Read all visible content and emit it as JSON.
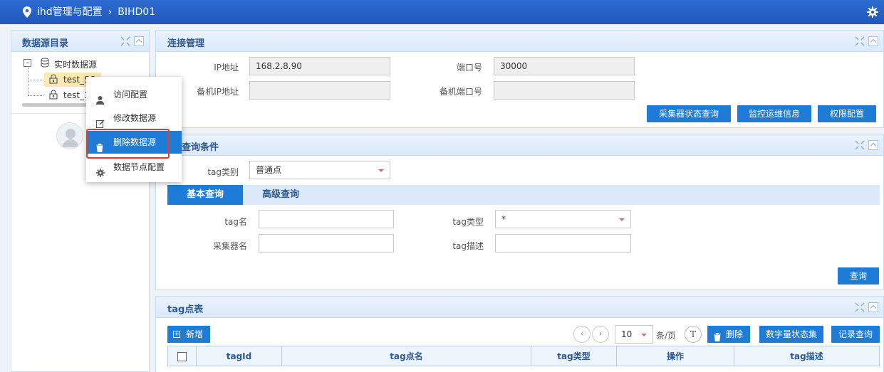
{
  "header": {
    "module": "ihd管理与配置",
    "item": "BIHD01"
  },
  "tree": {
    "title": "数据源目录",
    "root": "实时数据源",
    "children": [
      "test_SO",
      "test_1"
    ]
  },
  "context_menu": {
    "items": [
      "访问配置",
      "修改数据源",
      "删除数据源",
      "数据节点配置"
    ],
    "highlighted": "删除数据源"
  },
  "connection": {
    "title": "连接管理",
    "ip_label": "IP地址",
    "ip_value": "168.2.8.90",
    "port_label": "端口号",
    "port_value": "30000",
    "backup_ip_label": "备机IP地址",
    "backup_ip_value": "",
    "backup_port_label": "备机端口号",
    "backup_port_value": "",
    "buttons": [
      "采集器状态查询",
      "监控运维信息",
      "权限配置"
    ]
  },
  "query": {
    "title": "查询条件",
    "tag_type_label": "tag类别",
    "tag_type_value": "普通点",
    "tabs": [
      "基本查询",
      "高级查询"
    ],
    "tag_name_label": "tag名",
    "tag_name_value": "",
    "tag_kind_label": "tag类型",
    "tag_kind_value": "*",
    "collector_label": "采集器名",
    "collector_value": "",
    "tag_desc_label": "tag描述",
    "tag_desc_value": "",
    "search_button": "查询"
  },
  "tag_table": {
    "title": "tag点表",
    "add_button": "新增",
    "page_size": "10",
    "per_page_label": "条/页",
    "delete_button": "删除",
    "digital_state_button": "数字量状态集",
    "record_query_button": "记录查询",
    "columns": [
      "tagId",
      "tag点名",
      "tag类型",
      "操作",
      "tag描述"
    ]
  }
}
